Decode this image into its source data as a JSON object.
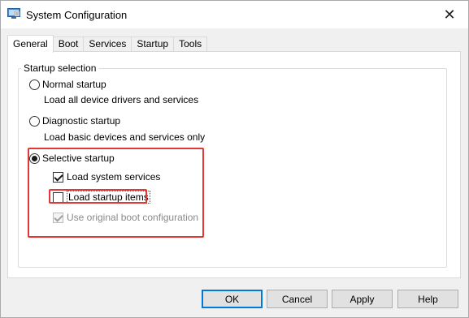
{
  "window": {
    "title": "System Configuration",
    "icon": "system-config-icon",
    "close_glyph": "✕"
  },
  "tabs": [
    {
      "label": "General",
      "active": true
    },
    {
      "label": "Boot",
      "active": false
    },
    {
      "label": "Services",
      "active": false
    },
    {
      "label": "Startup",
      "active": false
    },
    {
      "label": "Tools",
      "active": false
    }
  ],
  "startup_selection": {
    "legend": "Startup selection",
    "normal": {
      "label": "Normal startup",
      "description": "Load all device drivers and services",
      "selected": false
    },
    "diagnostic": {
      "label": "Diagnostic startup",
      "description": "Load basic devices and services only",
      "selected": false
    },
    "selective": {
      "label": "Selective startup",
      "selected": true,
      "load_system_services": {
        "label": "Load system services",
        "checked": true
      },
      "load_startup_items": {
        "label": "Load startup items",
        "checked": false
      },
      "use_original_boot": {
        "label": "Use original boot configuration",
        "checked": true,
        "disabled": true
      }
    }
  },
  "buttons": {
    "ok": "OK",
    "cancel": "Cancel",
    "apply": "Apply",
    "help": "Help"
  },
  "colors": {
    "highlight": "#e53636",
    "default_button_border": "#0078d7"
  }
}
